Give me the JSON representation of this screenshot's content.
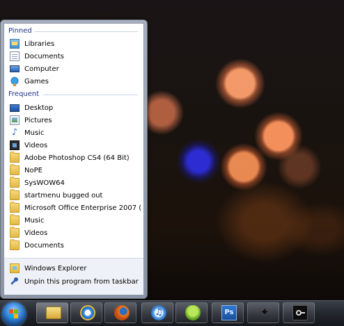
{
  "jumplist": {
    "pinned_header": "Pinned",
    "frequent_header": "Frequent",
    "pinned": [
      {
        "label": "Libraries",
        "icon": "libraries-icon"
      },
      {
        "label": "Documents",
        "icon": "documents-icon"
      },
      {
        "label": "Computer",
        "icon": "computer-icon"
      },
      {
        "label": "Games",
        "icon": "games-icon"
      }
    ],
    "frequent": [
      {
        "label": "Desktop",
        "icon": "desktop-icon"
      },
      {
        "label": "Pictures",
        "icon": "pictures-icon"
      },
      {
        "label": "Music",
        "icon": "music-icon"
      },
      {
        "label": "Videos",
        "icon": "videos-icon"
      },
      {
        "label": "Adobe Photoshop CS4 (64 Bit)",
        "icon": "folder-icon"
      },
      {
        "label": "NoPE",
        "icon": "folder-icon"
      },
      {
        "label": "SysWOW64",
        "icon": "folder-icon"
      },
      {
        "label": "startmenu bugged out",
        "icon": "folder-icon"
      },
      {
        "label": "Microsoft Office Enterprise 2007 (...",
        "icon": "folder-icon"
      },
      {
        "label": "Music",
        "icon": "folder-icon"
      },
      {
        "label": "Videos",
        "icon": "folder-icon"
      },
      {
        "label": "Documents",
        "icon": "folder-icon"
      }
    ],
    "tasks": [
      {
        "label": "Windows Explorer",
        "icon": "windows-explorer-icon"
      },
      {
        "label": "Unpin this program from taskbar",
        "icon": "unpin-icon"
      }
    ]
  },
  "taskbar": {
    "buttons": [
      {
        "name": "windows-explorer",
        "icon": "folder-icon"
      },
      {
        "name": "internet-explorer",
        "icon": "internet-explorer-icon"
      },
      {
        "name": "firefox",
        "icon": "firefox-icon"
      },
      {
        "name": "itunes",
        "icon": "itunes-icon"
      },
      {
        "name": "messenger",
        "icon": "messenger-icon"
      },
      {
        "name": "photoshop",
        "icon": "photoshop-icon",
        "text": "Ps"
      },
      {
        "name": "bird-app",
        "icon": "bird-icon"
      },
      {
        "name": "steam",
        "icon": "steam-icon"
      }
    ]
  },
  "colors": {
    "header": "#1e3287",
    "taskbar": "#22262d"
  }
}
